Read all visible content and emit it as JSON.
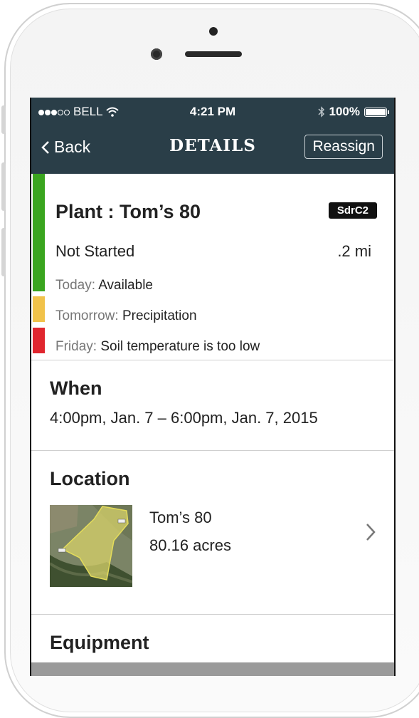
{
  "status_bar": {
    "carrier": "BELL",
    "time": "4:21 PM",
    "battery": "100%"
  },
  "nav": {
    "back_label": "Back",
    "title": "DETAILS",
    "reassign_label": "Reassign"
  },
  "task": {
    "title": "Plant : Tom’s 80",
    "code": "SdrC2",
    "status": "Not Started",
    "distance": ".2 mi",
    "forecast": [
      {
        "day": "Today:",
        "condition": "Available",
        "color": "#3aa51f"
      },
      {
        "day": "Tomorrow:",
        "condition": "Precipitation",
        "color": "#f1c24a"
      },
      {
        "day": "Friday:",
        "condition": "Soil temperature is too low",
        "color": "#e0262e"
      }
    ]
  },
  "when": {
    "heading": "When",
    "value": "4:00pm, Jan. 7 – 6:00pm, Jan. 7, 2015"
  },
  "location": {
    "heading": "Location",
    "field_name": "Tom’s 80",
    "field_area": "80.16 acres"
  },
  "equipment": {
    "heading": "Equipment"
  },
  "colors": {
    "nav_bg": "#2a3e48",
    "accent_green": "#3aa51f",
    "accent_yellow": "#f1c24a",
    "accent_red": "#e0262e"
  }
}
